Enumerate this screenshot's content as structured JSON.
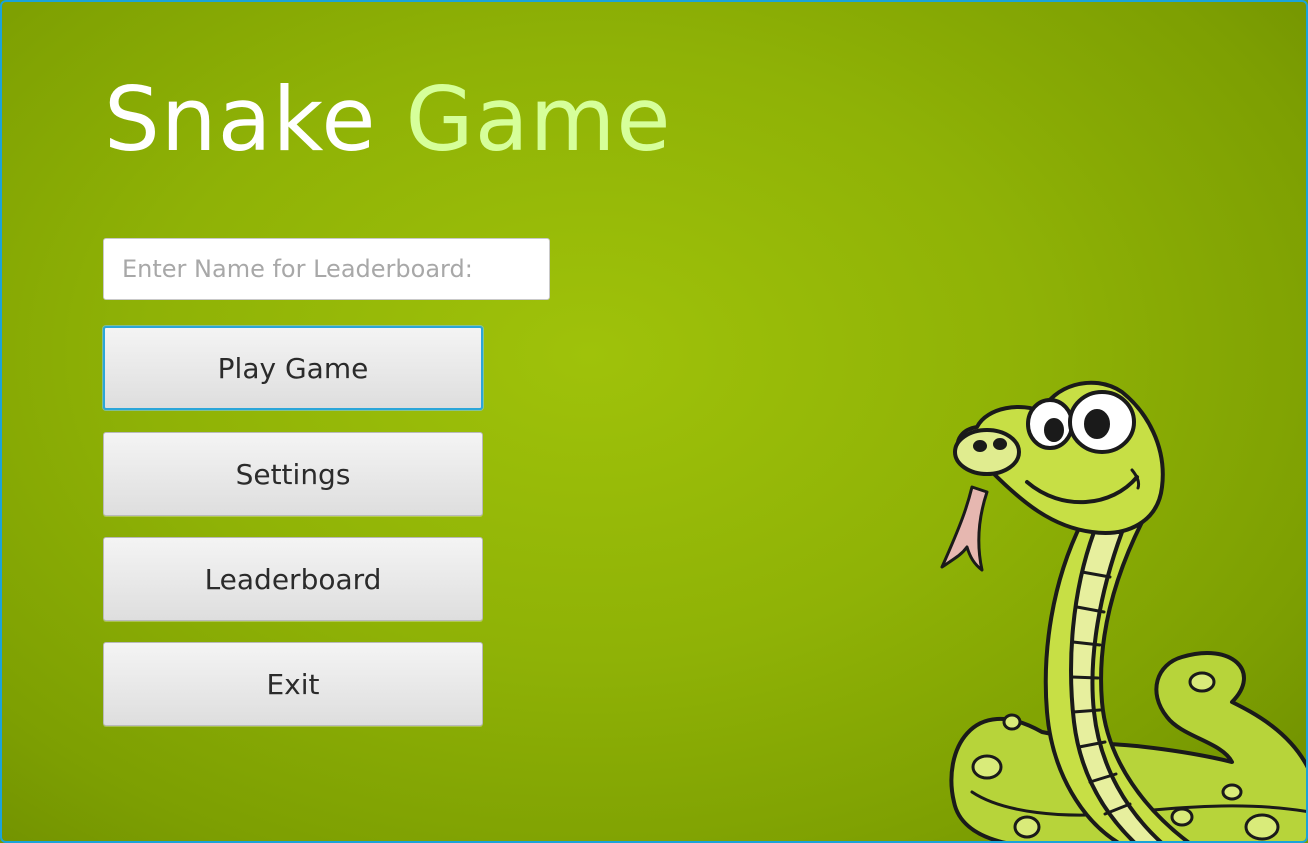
{
  "window": {
    "title_part1": "Snake",
    "title_part2": "Game"
  },
  "name_input": {
    "value": "",
    "placeholder": "Enter Name for Leaderboard:"
  },
  "menu": {
    "play_label": "Play Game",
    "settings_label": "Settings",
    "leaderboard_label": "Leaderboard",
    "exit_label": "Exit"
  },
  "colors": {
    "background": "#8fb206",
    "title_primary": "#ffffff",
    "title_accent": "#d6ff9a",
    "focus_border": "#2ba6d9"
  },
  "icons": {
    "mascot": "cartoon-snake-illustration"
  }
}
